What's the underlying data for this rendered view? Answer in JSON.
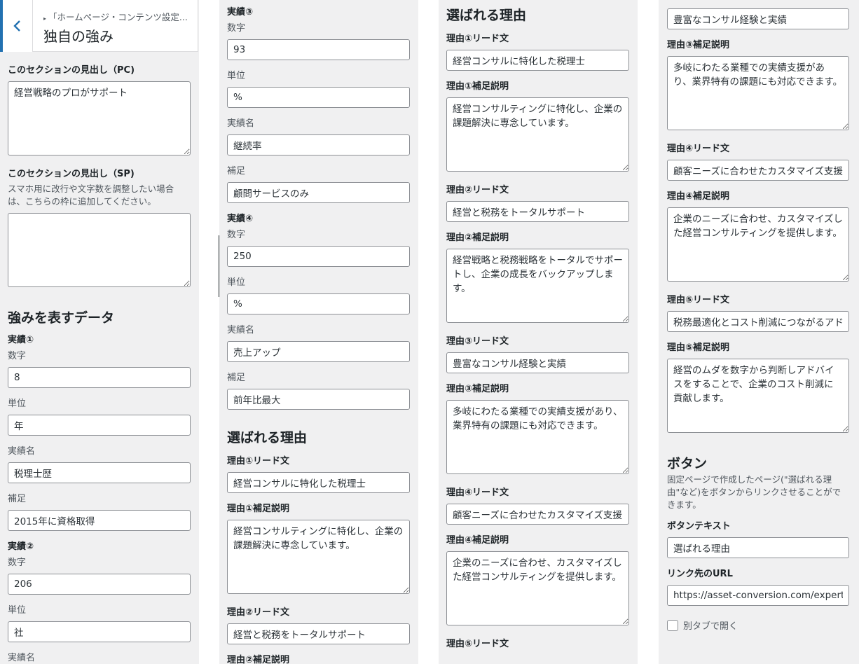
{
  "header": {
    "breadcrumb": "「ホームページ・コンテンツ設定...",
    "title": "独自の強み"
  },
  "col1": {
    "pc_heading_label": "このセクションの見出し（PC)",
    "pc_heading_value": "経営戦略のプロがサポート",
    "sp_heading_label": "このセクションの見出し（SP)",
    "sp_heading_desc": "スマホ用に改行や文字数を調整したい場合は、こちらの枠に追加してください。",
    "sp_heading_value": "",
    "data_heading": "強みを表すデータ",
    "a1": {
      "label": "実績①",
      "num_label": "数字",
      "num": "8",
      "unit_label": "単位",
      "unit": "年",
      "name_label": "実績名",
      "name": "税理士歴",
      "note_label": "補足",
      "note": "2015年に資格取得"
    },
    "a2": {
      "label": "実績②",
      "num_label": "数字",
      "num": "206",
      "unit_label": "単位",
      "unit": "社",
      "name_label": "実績名"
    }
  },
  "col2": {
    "a3": {
      "label": "実績③",
      "num_label": "数字",
      "num": "93",
      "unit_label": "単位",
      "unit": "%",
      "name_label": "実績名",
      "name": "継続率",
      "note_label": "補足",
      "note": "顧問サービスのみ"
    },
    "a4": {
      "label": "実績④",
      "num_label": "数字",
      "num": "250",
      "unit_label": "単位",
      "unit": "%",
      "name_label": "実績名",
      "name": "売上アップ",
      "note_label": "補足",
      "note": "前年比最大"
    },
    "reasons_heading": "選ばれる理由",
    "r1_lead_label": "理由①リード文",
    "r1_lead": "経営コンサルに特化した税理士",
    "r1_desc_label": "理由①補足説明",
    "r1_desc": "経営コンサルティングに特化し、企業の課題解決に専念しています。",
    "r2_lead_label": "理由②リード文",
    "r2_lead": "経営と税務をトータルサポート",
    "r2_desc_label": "理由②補足説明"
  },
  "col3": {
    "reasons_heading": "選ばれる理由",
    "r1_lead_label": "理由①リード文",
    "r1_lead": "経営コンサルに特化した税理士",
    "r1_desc_label": "理由①補足説明",
    "r1_desc": "経営コンサルティングに特化し、企業の課題解決に専念しています。",
    "r2_lead_label": "理由②リード文",
    "r2_lead": "経営と税務をトータルサポート",
    "r2_desc_label": "理由②補足説明",
    "r2_desc": "経営戦略と税務戦略をトータルでサポートし、企業の成長をバックアップします。",
    "r3_lead_label": "理由③リード文",
    "r3_lead": "豊富なコンサル経験と実績",
    "r3_desc_label": "理由③補足説明",
    "r3_desc": "多岐にわたる業種での実績支援があり、業界特有の課題にも対応できます。",
    "r4_lead_label": "理由④リード文",
    "r4_lead": "顧客ニーズに合わせたカスタマイズ支援",
    "r4_desc_label": "理由④補足説明",
    "r4_desc": "企業のニーズに合わせ、カスタマイズした経営コンサルティングを提供します。",
    "r5_lead_label": "理由⑤リード文"
  },
  "col4": {
    "r3_lead": "豊富なコンサル経験と実績",
    "r3_desc_label": "理由③補足説明",
    "r3_desc": "多岐にわたる業種での実績支援があり、業界特有の課題にも対応できます。",
    "r4_lead_label": "理由④リード文",
    "r4_lead": "顧客ニーズに合わせたカスタマイズ支援",
    "r4_desc_label": "理由④補足説明",
    "r4_desc": "企業のニーズに合わせ、カスタマイズした経営コンサルティングを提供します。",
    "r5_lead_label": "理由⑤リード文",
    "r5_lead": "税務最適化とコスト削減につながるアドバイス",
    "r5_desc_label": "理由⑤補足説明",
    "r5_desc": "経営のムダを数字から判断しアドバイスをすることで、企業のコスト削減に貢献します。",
    "button_heading": "ボタン",
    "button_desc": "固定ページで作成したページ(\"選ばれる理由\"など)をボタンからリンクさせることができます。",
    "button_text_label": "ボタンテキスト",
    "button_text": "選ばれる理由",
    "link_url_label": "リンク先のURL",
    "link_url": "https://asset-conversion.com/expert/strength",
    "new_tab_label": "別タブで開く"
  }
}
